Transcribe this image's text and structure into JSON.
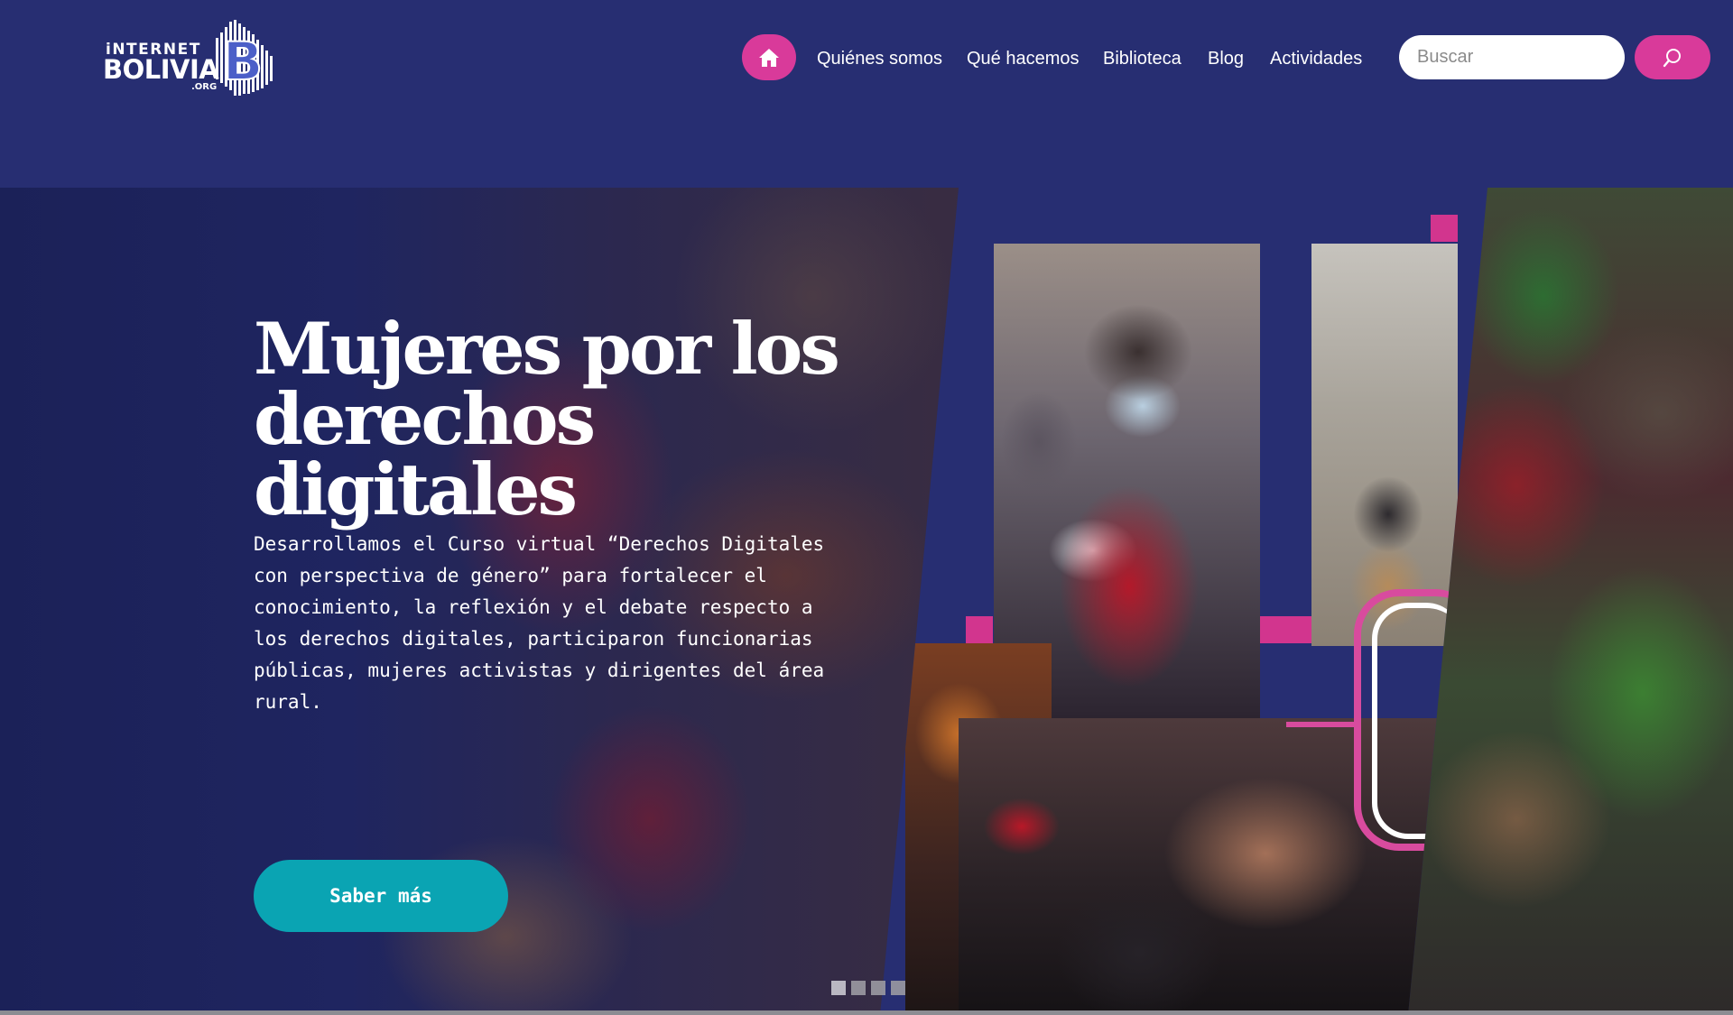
{
  "logo": {
    "line1": "iNTERNET",
    "line2": "BOLIVIA",
    "suffix": ".ORG",
    "monogram": "B",
    "colors": {
      "text": "#ffffff",
      "mark": "#4b5fc8"
    }
  },
  "nav": {
    "home_icon": "home-icon",
    "items": [
      {
        "label": "Quiénes somos"
      },
      {
        "label": "Qué hacemos"
      },
      {
        "label": "Biblioteca"
      },
      {
        "label": "Blog"
      },
      {
        "label": "Actividades"
      }
    ]
  },
  "search": {
    "placeholder": "Buscar",
    "value": "",
    "button_icon": "search-icon"
  },
  "hero": {
    "title_line1": "Mujeres por los",
    "title_line2": "derechos digitales",
    "text": "Desarrollamos el Curso virtual “Derechos Digitales con perspectiva de género” para fortalecer el conocimiento, la reflexión y el debate respecto a los derechos digitales, participaron funcionarias públicas, mujeres activistas y dirigentes del área rural.",
    "cta_label": "Saber más"
  },
  "slider": {
    "total_slides": 4,
    "active_index": 0
  },
  "colors": {
    "background": "#272e72",
    "accent_pink": "#d93a9a",
    "accent_teal": "#0aa4b3",
    "text": "#ffffff"
  }
}
